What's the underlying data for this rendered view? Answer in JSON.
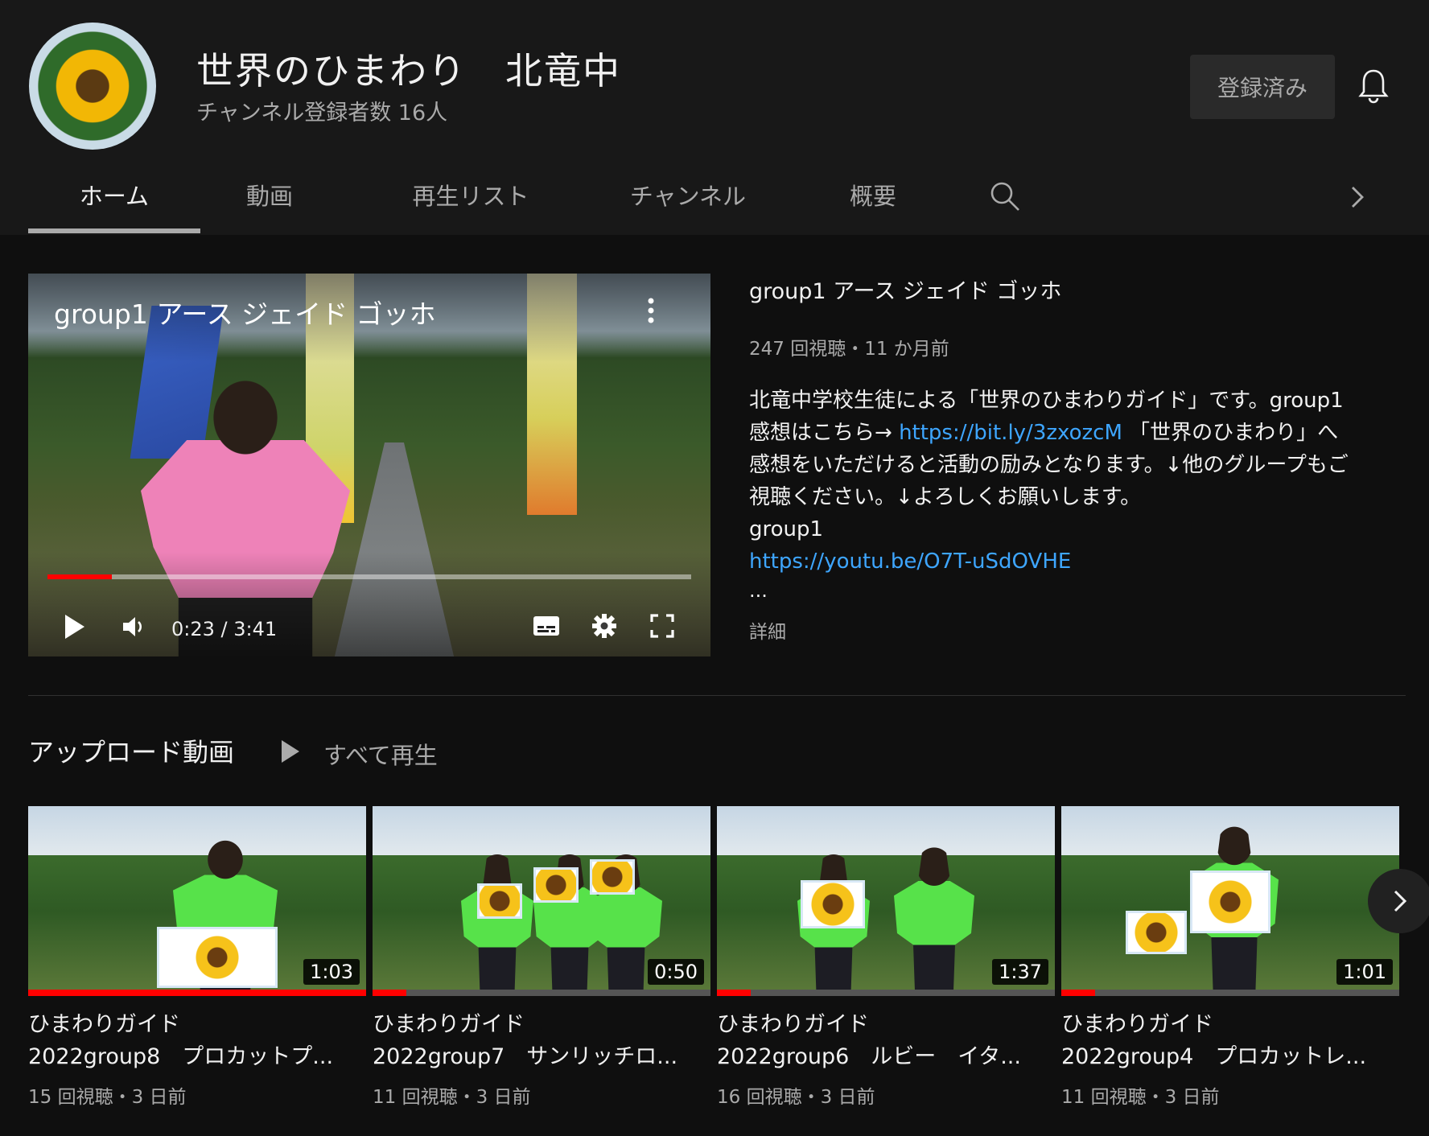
{
  "channel": {
    "name": "世界のひまわり　北竜中",
    "subscribers": "チャンネル登録者数 16人",
    "subscribe_button": "登録済み",
    "icons": {
      "bell": "bell-icon",
      "avatar": "sunflower-avatar"
    }
  },
  "tabs": [
    {
      "label": "ホーム",
      "active": true
    },
    {
      "label": "動画"
    },
    {
      "label": "再生リスト"
    },
    {
      "label": "チャンネル"
    },
    {
      "label": "概要"
    }
  ],
  "featured": {
    "player_title": "group1 アース ジェイド ゴッホ",
    "time": "0:23 / 3:41",
    "progress": 0.1,
    "title": "group1 アース ジェイド ゴッホ",
    "meta": "247 回視聴・11 か月前",
    "desc_1": "北竜中学校生徒による「世界のひまわりガイド」です。group1",
    "desc_2a": "感想はこちら→ ",
    "desc_link1": "https://bit.ly/3zxozcM",
    "desc_2b": "「世界のひまわり」へ",
    "desc_3": "感想をいただけると活動の励みとなります。↓他のグループもご",
    "desc_4": "視聴ください。↓よろしくお願いします。",
    "desc_5": "group1",
    "desc_link2": "https://youtu.be/O7T-uSdOVHE",
    "desc_ellipsis": "...",
    "details": "詳細"
  },
  "uploads": {
    "title": "アップロード動画",
    "play_all": "すべて再生",
    "videos": [
      {
        "line1": "ひまわりガイド",
        "line2": "2022group8　プロカットプ...",
        "duration": "1:03",
        "meta": "15 回視聴・3 日前",
        "watched": 1.0
      },
      {
        "line1": "ひまわりガイド",
        "line2": "2022group7　サンリッチロ...",
        "duration": "0:50",
        "meta": "11 回視聴・3 日前",
        "watched": 0.1
      },
      {
        "line1": "ひまわりガイド",
        "line2": "2022group6　ルビー　イタ...",
        "duration": "1:37",
        "meta": "16 回視聴・3 日前",
        "watched": 0.1
      },
      {
        "line1": "ひまわりガイド",
        "line2": "2022group4　プロカットレ...",
        "duration": "1:01",
        "meta": "11 回視聴・3 日前",
        "watched": 0.1
      }
    ]
  },
  "colors": {
    "accent": "#ff0000",
    "link": "#3ea6ff",
    "background": "#0f0f0f",
    "header": "#181818"
  }
}
